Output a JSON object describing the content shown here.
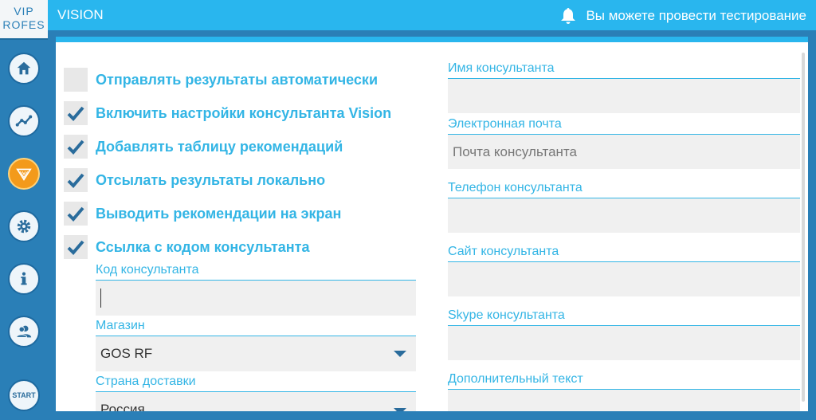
{
  "sidebar": {
    "logo_line1": "VIP",
    "logo_line2": "ROFES",
    "items": [
      {
        "icon": "home-icon"
      },
      {
        "icon": "chart-icon"
      },
      {
        "icon": "vision-icon",
        "active": true
      },
      {
        "icon": "gear-icon"
      },
      {
        "icon": "info-icon"
      },
      {
        "icon": "users-icon"
      }
    ],
    "start_label": "START"
  },
  "header": {
    "title": "VISION",
    "notification": "Вы можете провести тестирование"
  },
  "colors": {
    "accent": "#29b6ee",
    "label": "#33b5e5",
    "sidebar": "#2a7fb7",
    "active": "#f39a1b"
  },
  "settings": {
    "checkboxes": [
      {
        "label": "Отправлять результаты автоматически",
        "checked": false
      },
      {
        "label": "Включить настройки консультанта Vision",
        "checked": true
      },
      {
        "label": "Добавлять таблицу рекомендаций",
        "checked": true
      },
      {
        "label": "Отсылать результаты локально",
        "checked": true
      },
      {
        "label": "Выводить рекомендации на экран",
        "checked": true
      },
      {
        "label": "Ссылка с кодом консультанта",
        "checked": true
      }
    ],
    "consultant_code_label": "Код консультанта",
    "consultant_code_value": "",
    "store_label": "Магазин",
    "store_value": "GOS RF",
    "country_label": "Страна доставки",
    "country_value": "Россия"
  },
  "consultant": {
    "name_label": "Имя консультанта",
    "name_value": "",
    "email_label": "Электронная почта",
    "email_placeholder": "Почта консультанта",
    "phone_label": "Телефон консультанта",
    "phone_value": "",
    "site_label": "Сайт консультанта",
    "site_value": "",
    "skype_label": "Skype консультанта",
    "skype_value": "",
    "extra_label": "Дополнительный текст",
    "extra_value": ""
  }
}
